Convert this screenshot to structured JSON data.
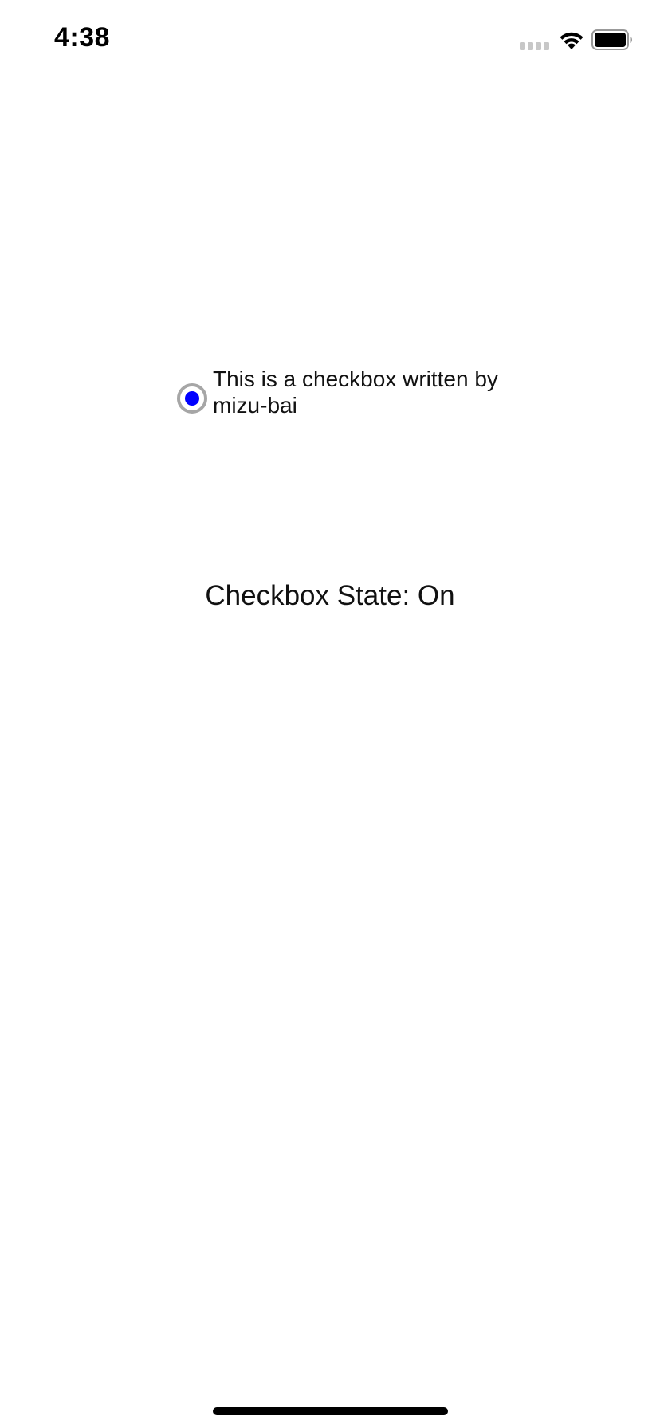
{
  "status_bar": {
    "time": "4:38",
    "signal_icon": "cellular-signal-icon",
    "wifi_icon": "wifi-icon",
    "battery_icon": "battery-icon"
  },
  "checkbox": {
    "label": "This is a checkbox written by mizu-bai",
    "checked": true,
    "accent_color": "#0000ff",
    "ring_color": "#a6a6a6"
  },
  "state": {
    "text": "Checkbox State: On"
  }
}
